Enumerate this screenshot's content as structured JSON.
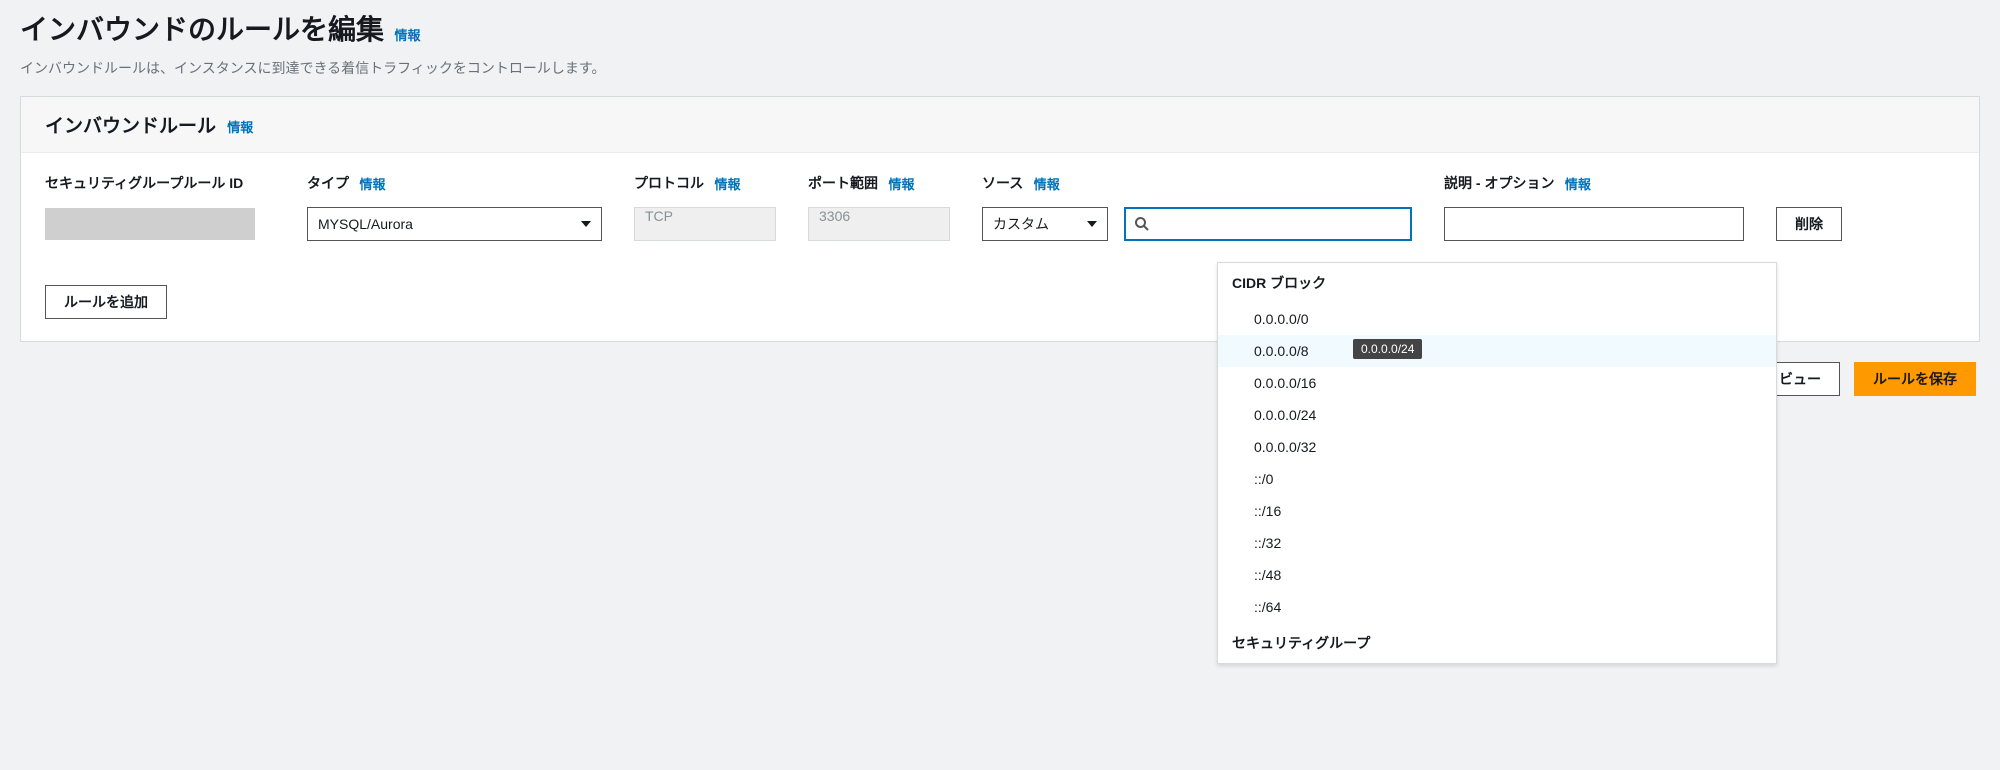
{
  "page": {
    "title": "インバウンドのルールを編集",
    "title_info": "情報",
    "description": "インバウンドルールは、インスタンスに到達できる着信トラフィックをコントロールします。"
  },
  "panel": {
    "title": "インバウンドルール",
    "title_info": "情報",
    "columns": {
      "rule_id": "セキュリティグループルール ID",
      "type": "タイプ",
      "type_info": "情報",
      "protocol": "プロトコル",
      "protocol_info": "情報",
      "port": "ポート範囲",
      "port_info": "情報",
      "source": "ソース",
      "source_info": "情報",
      "description": "説明 - オプション",
      "description_info": "情報"
    },
    "row": {
      "type_value": "MYSQL/Aurora",
      "protocol_value": "TCP",
      "port_value": "3306",
      "source_mode": "カスタム",
      "source_value": "",
      "description_value": "",
      "delete_label": "削除"
    },
    "add_rule_label": "ルールを追加"
  },
  "footer": {
    "preview_label": "ビュー",
    "save_label": "ルールを保存"
  },
  "dropdown": {
    "cidr_header": "CIDR ブロック",
    "items": [
      "0.0.0.0/0",
      "0.0.0.0/8",
      "0.0.0.0/16",
      "0.0.0.0/24",
      "0.0.0.0/32",
      "::/0",
      "::/16",
      "::/32",
      "::/48",
      "::/64"
    ],
    "highlight_index": 1,
    "tooltip_text": "0.0.0.0/24",
    "sg_header": "セキュリティグループ"
  }
}
